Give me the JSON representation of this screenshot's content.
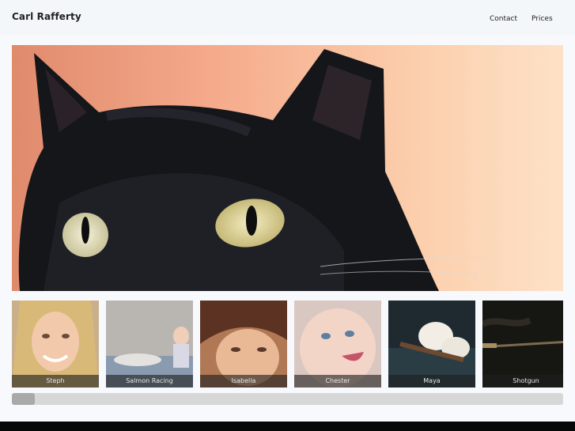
{
  "header": {
    "brand": "Carl Rafferty",
    "nav": [
      {
        "label": "Contact"
      },
      {
        "label": "Prices"
      }
    ]
  },
  "hero": {
    "subject": "black cat close-up"
  },
  "gallery": {
    "items": [
      {
        "caption": "Steph"
      },
      {
        "caption": "Salmon Racing"
      },
      {
        "caption": "Isabella"
      },
      {
        "caption": "Chester"
      },
      {
        "caption": "Maya"
      },
      {
        "caption": "Shotgun"
      }
    ],
    "scroll_position": 0.0
  },
  "colors": {
    "header_bg": "#f4f7fa",
    "page_bg": "#f7f9fc",
    "caption_bg": "#3a3a3a",
    "scroll_track": "#d7d7d7",
    "scroll_thumb": "#a9a9a9"
  }
}
